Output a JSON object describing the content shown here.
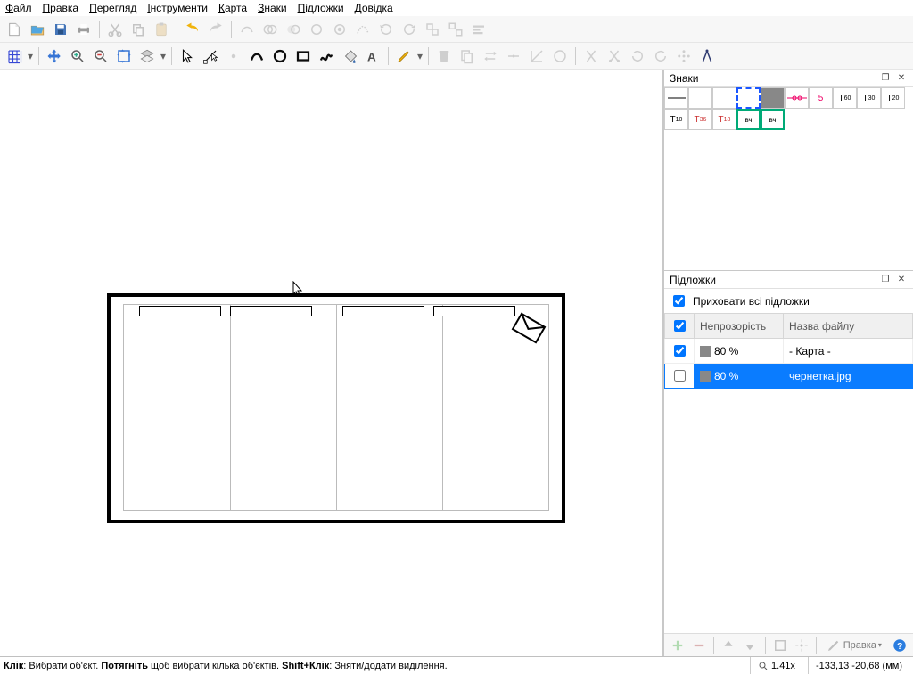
{
  "menu": {
    "file": "Файл",
    "edit": "Правка",
    "view": "Перегляд",
    "tools": "Інструменти",
    "map": "Карта",
    "signs": "Знаки",
    "layers": "Підложки",
    "help": "Довідка"
  },
  "panels": {
    "signs": {
      "title": "Знаки",
      "items": {
        "s5": "5",
        "t60": "T₆₀",
        "t30": "T₃₀",
        "t20": "T₂₀",
        "t10": "T₁₀",
        "t36": "T₃₆",
        "t18": "T₁₈",
        "bc1": "вч",
        "bc2": "вч"
      }
    },
    "layers": {
      "title": "Підложки",
      "hide_label": "Приховати всі підложки",
      "columns": {
        "c1": "",
        "c2": "Непрозорість",
        "c3": "Назва файлу"
      },
      "rows": [
        {
          "checked": true,
          "opacity": "80 %",
          "name": "- Карта -"
        },
        {
          "checked": false,
          "opacity": "80 %",
          "name": "чернетка.jpg"
        }
      ],
      "edit_btn": "Правка"
    }
  },
  "status": {
    "hint_prefix1": "Клік",
    "hint_text1": ": Вибрати об'єкт. ",
    "hint_prefix2": "Потягніть",
    "hint_text2": " щоб вибрати кілька об'єктів. ",
    "hint_prefix3": "Shift+Клік",
    "hint_text3": ": Зняти/додати виділення.",
    "zoom": "1.41x",
    "coords": "-133,13 -20,68 (мм)"
  }
}
